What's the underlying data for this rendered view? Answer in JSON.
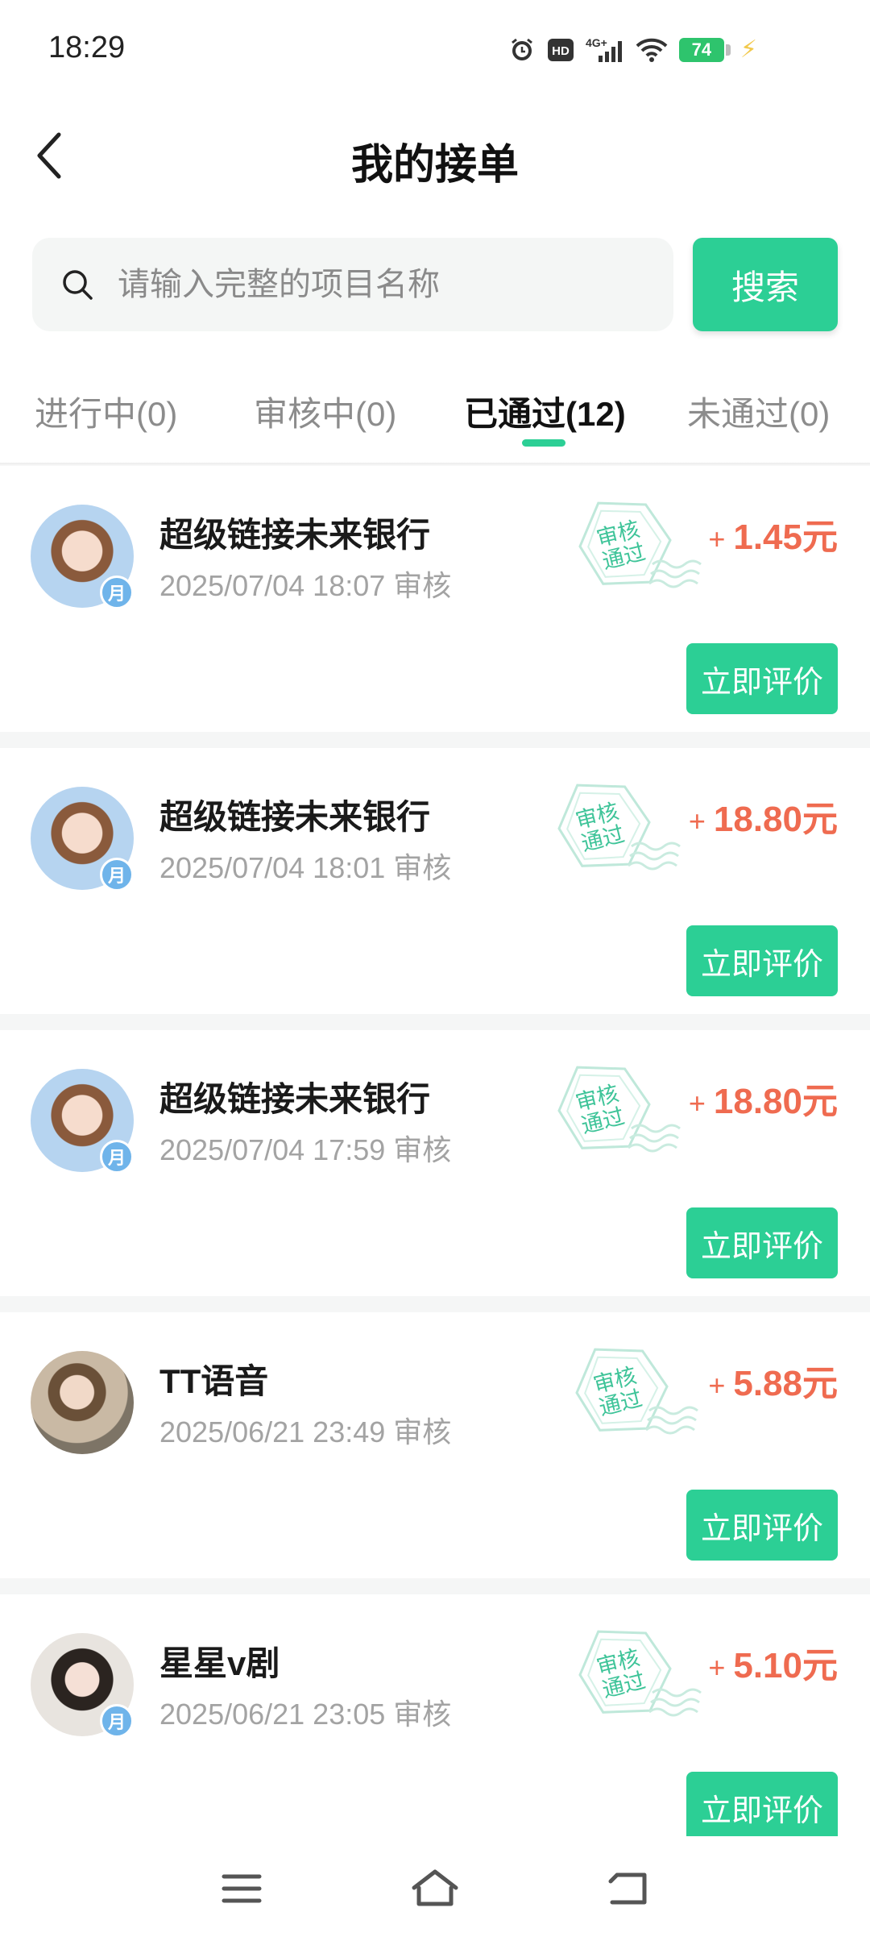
{
  "status_bar": {
    "time": "18:29",
    "battery": "74",
    "icons": [
      "alarm-icon",
      "hd-icon",
      "signal-4g-icon",
      "wifi-icon",
      "battery-icon",
      "charging-icon"
    ],
    "hd_label": "HD",
    "network_label": "4G+"
  },
  "header": {
    "title": "我的接单",
    "back_icon": "chevron-left-icon"
  },
  "search": {
    "placeholder": "请输入完整的项目名称",
    "button_label": "搜索",
    "icon": "search-icon"
  },
  "tabs": [
    {
      "label": "进行中(0)",
      "active": false
    },
    {
      "label": "审核中(0)",
      "active": false
    },
    {
      "label": "已通过(12)",
      "active": true
    },
    {
      "label": "未通过(0)",
      "active": false
    }
  ],
  "colors": {
    "accent": "#2ccf95",
    "amount": "#ef6b50",
    "stamp": "#3fc499",
    "muted": "#a3a3a3"
  },
  "orders": [
    {
      "title": "超级链接未来银行",
      "time": "2025/07/04 18:07 审核",
      "stamp_line1": "审核",
      "stamp_line2": "通过",
      "plus": "+",
      "amount": "1.45元",
      "button": "立即评价",
      "badge": "月"
    },
    {
      "title": "超级链接未来银行",
      "time": "2025/07/04 18:01 审核",
      "stamp_line1": "审核",
      "stamp_line2": "通过",
      "plus": "+",
      "amount": "18.80元",
      "button": "立即评价",
      "badge": "月"
    },
    {
      "title": "超级链接未来银行",
      "time": "2025/07/04 17:59 审核",
      "stamp_line1": "审核",
      "stamp_line2": "通过",
      "plus": "+",
      "amount": "18.80元",
      "button": "立即评价",
      "badge": "月"
    },
    {
      "title": "TT语音",
      "time": "2025/06/21 23:49 审核",
      "stamp_line1": "审核",
      "stamp_line2": "通过",
      "plus": "+",
      "amount": "5.88元",
      "button": "立即评价",
      "badge": ""
    },
    {
      "title": "星星v剧",
      "time": "2025/06/21 23:05 审核",
      "stamp_line1": "审核",
      "stamp_line2": "通过",
      "plus": "+",
      "amount": "5.10元",
      "button": "立即评价",
      "badge": "月"
    }
  ],
  "nav": {
    "icons": [
      "menu-icon",
      "home-icon",
      "back-icon"
    ]
  }
}
